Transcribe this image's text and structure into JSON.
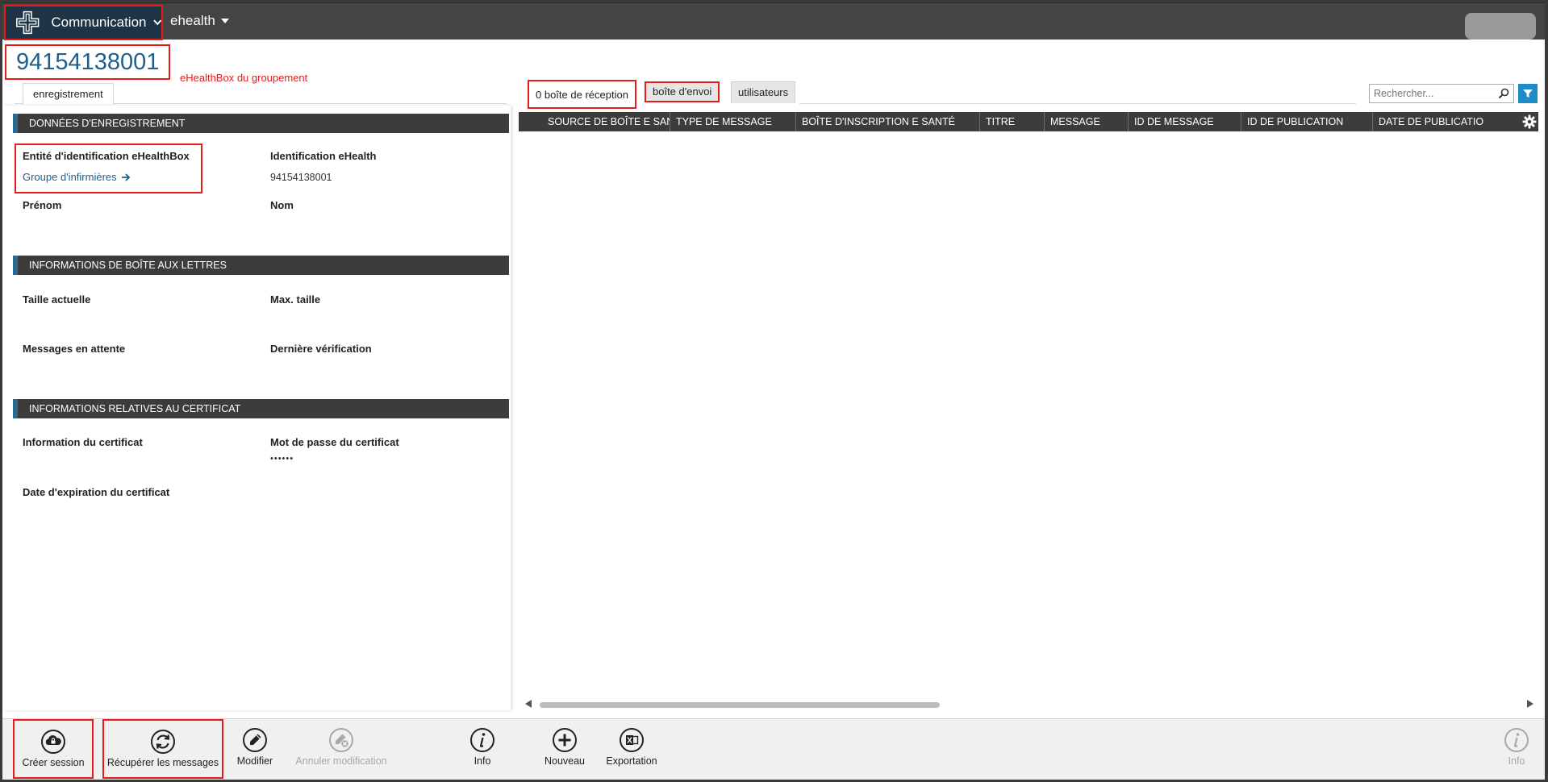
{
  "topbar": {
    "module_label": "Communication",
    "environment_label": "ehealth"
  },
  "header": {
    "entity_id": "94154138001",
    "subtitle": "eHealthBox du groupement"
  },
  "left": {
    "tab_label": "enregistrement",
    "section_registration": {
      "title": "DONNÉES D'ENREGISTREMENT",
      "id_entity_label": "Entité d'identification eHealthBox",
      "id_entity_value": "Groupe d'infirmières",
      "ehealth_id_label": "Identification eHealth",
      "ehealth_id_value": "94154138001",
      "firstname_label": "Prénom",
      "lastname_label": "Nom"
    },
    "section_mailbox": {
      "title": "INFORMATIONS DE BOÎTE AUX LETTRES",
      "current_size_label": "Taille actuelle",
      "max_size_label": "Max. taille",
      "pending_label": "Messages en attente",
      "last_check_label": "Dernière vérification"
    },
    "section_cert": {
      "title": "INFORMATIONS RELATIVES AU CERTIFICAT",
      "cert_info_label": "Information du certificat",
      "cert_password_label": "Mot de passe du certificat",
      "cert_password_value": "••••••",
      "cert_expiry_label": "Date d'expiration du certificat"
    }
  },
  "right": {
    "tabs": {
      "inbox": "0 boîte de réception",
      "outbox": "boîte d'envoi",
      "users": "utilisateurs"
    },
    "search_placeholder": "Rechercher...",
    "columns": [
      "SOURCE DE BOÎTE E SANTÉ",
      "TYPE DE MESSAGE",
      "BOÎTE D'INSCRIPTION E SANTÉ",
      "TITRE",
      "MESSAGE",
      "ID DE MESSAGE",
      "ID DE PUBLICATION",
      "DATE DE PUBLICATIO"
    ],
    "sort_indicator": "▲"
  },
  "toolbar": {
    "create_session": "Créer session",
    "fetch_messages": "Récupérer les messages",
    "modify": "Modifier",
    "cancel_modify": "Annuler modification",
    "info": "Info",
    "new": "Nouveau",
    "export": "Exportation",
    "info_right": "Info"
  },
  "colors": {
    "accent": "#1f5f8b",
    "highlight": "#e81b1b",
    "header_dark": "#3c3c3c"
  }
}
